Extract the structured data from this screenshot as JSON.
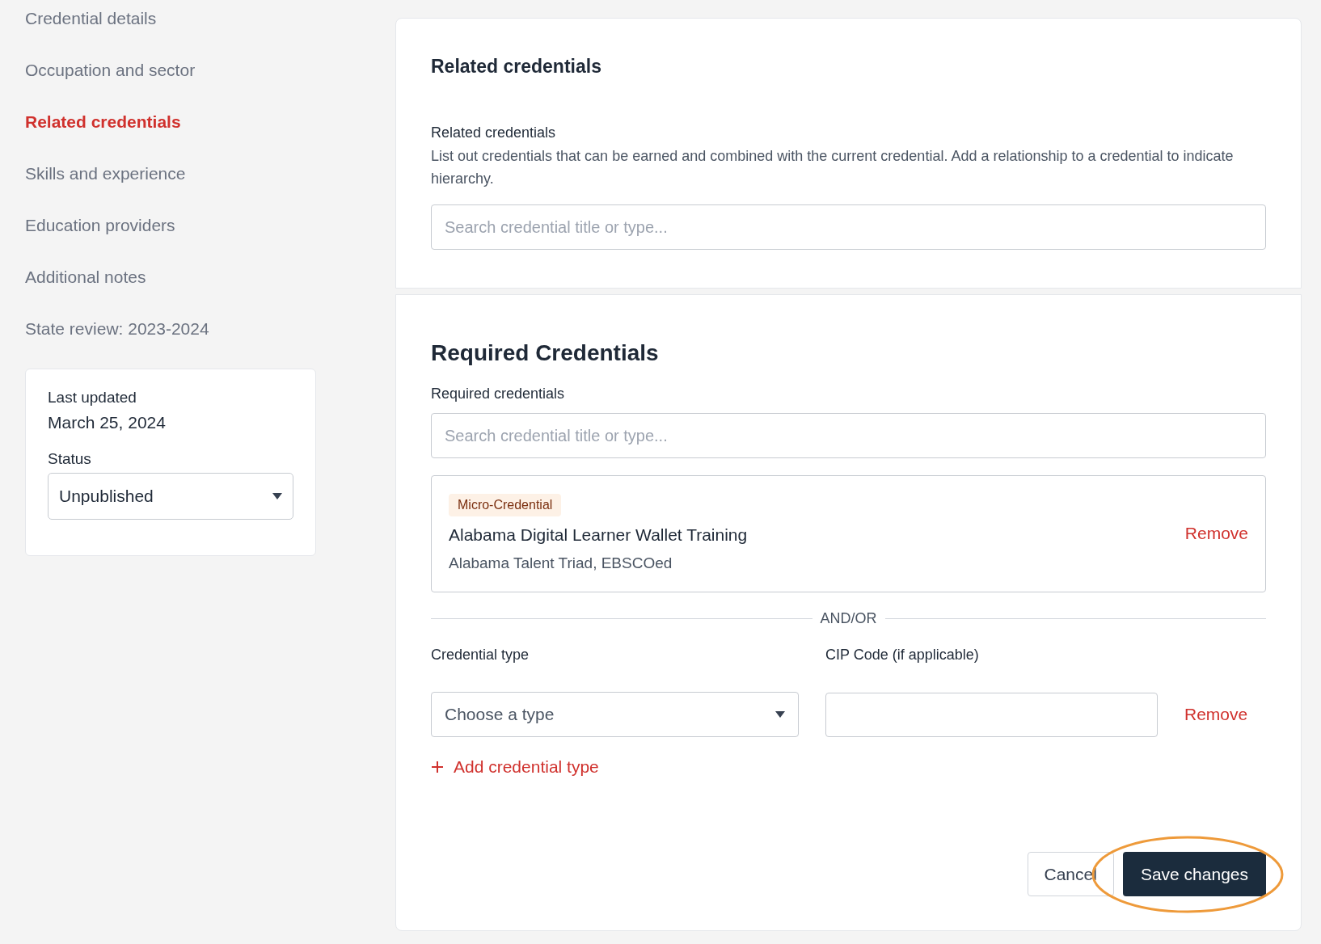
{
  "sidebar": {
    "items": [
      {
        "label": "Credential details",
        "selected": false
      },
      {
        "label": "Occupation and sector",
        "selected": false
      },
      {
        "label": "Related credentials",
        "selected": true
      },
      {
        "label": "Skills and experience",
        "selected": false
      },
      {
        "label": "Education providers",
        "selected": false
      },
      {
        "label": "Additional notes",
        "selected": false
      },
      {
        "label": "State review: 2023-2024",
        "selected": false
      }
    ]
  },
  "status_card": {
    "last_updated_label": "Last updated",
    "last_updated": "March 25, 2024",
    "status_label": "Status",
    "status": "Unpublished"
  },
  "related_section": {
    "title": "Related credentials",
    "field_label": "Related credentials",
    "description": "List out credentials that can be earned and combined with the current credential. Add a relationship to a credential to indicate hierarchy.",
    "search": {
      "placeholder": "Search credential title or type..."
    }
  },
  "required_section": {
    "title": "Required Credentials",
    "field_label": "Required credentials",
    "search": {
      "placeholder": "Search credential title or type..."
    },
    "credentials": [
      {
        "tag": "Micro-Credential",
        "title": "Alabama Digital Learner Wallet Training",
        "providers": "Alabama Talent Triad, EBSCOed",
        "remove": "Remove"
      }
    ],
    "divider": "AND/OR",
    "type_label": "Credential type",
    "type_select": "Choose a type",
    "cip_label": "CIP Code (if applicable)",
    "type_remove": "Remove",
    "add_type": "Add credential type"
  },
  "actions": {
    "cancel": "Cancel",
    "save": "Save changes",
    "highlighted": true
  }
}
